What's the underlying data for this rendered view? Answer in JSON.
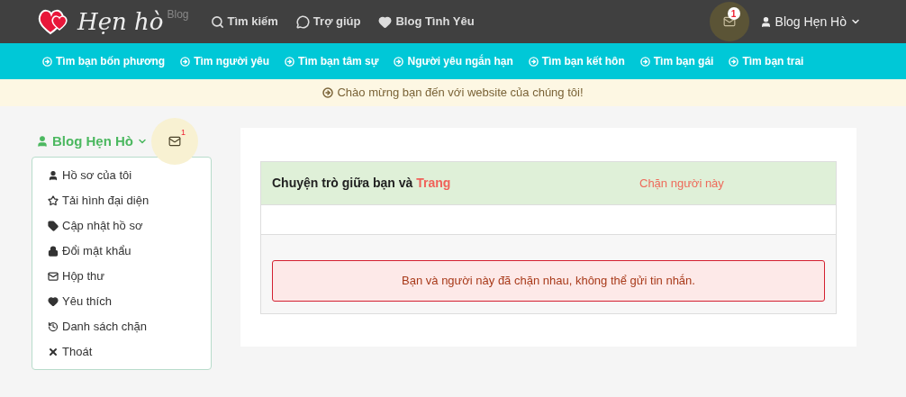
{
  "logo": {
    "text": "Hẹn hò",
    "sup": "Blog"
  },
  "top_nav": [
    "Tìm kiếm",
    "Trợ giúp",
    "Blog Tình Yêu"
  ],
  "mail_badge": "1",
  "user_menu": "Blog Hẹn Hò",
  "category_nav": [
    "Tìm bạn bốn phương",
    "Tìm người yêu",
    "Tìm bạn tâm sự",
    "Người yêu ngắn hạn",
    "Tìm bạn kết hôn",
    "Tìm bạn gái",
    "Tìm bạn trai"
  ],
  "notice": "Chào mừng bạn đến với website của chúng tôi!",
  "sidebar": {
    "user": "Blog Hẹn Hò",
    "mail_badge": "1",
    "items": [
      "Hồ sơ của tôi",
      "Tải hình đại diện",
      "Cập nhật hồ sơ",
      "Đổi mật khẩu",
      "Hộp thư",
      "Yêu thích",
      "Danh sách chặn",
      "Thoát"
    ]
  },
  "chat": {
    "title": "Chuyện trò giữa bạn và",
    "partner": "Trang",
    "block_link": "Chặn người này",
    "alert": "Bạn và người này đã chặn nhau, không thể gửi tin nhắn."
  }
}
